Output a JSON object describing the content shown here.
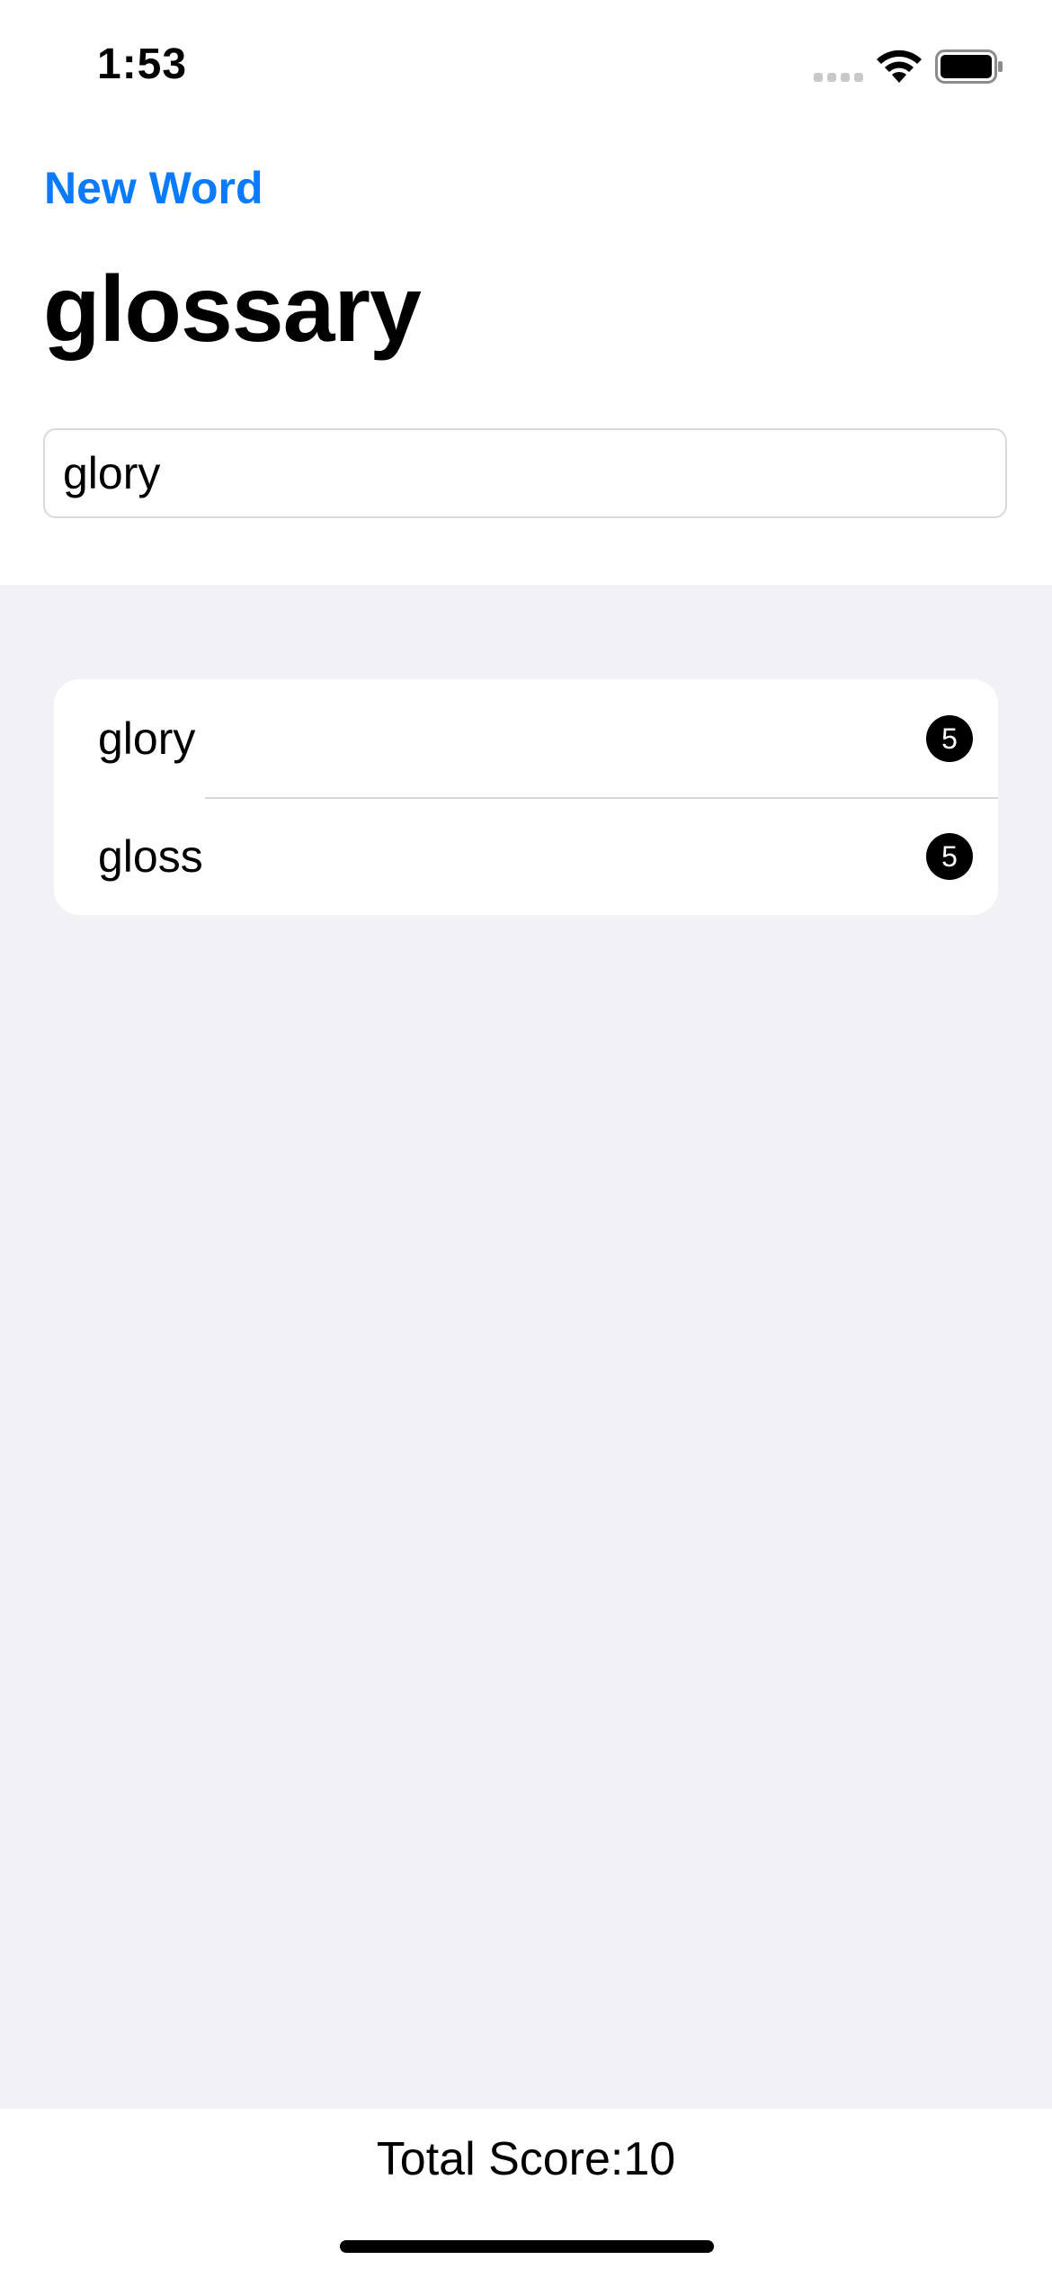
{
  "status_bar": {
    "time": "1:53",
    "icons": [
      "signal-icon",
      "wifi-icon",
      "battery-icon"
    ]
  },
  "nav": {
    "new_word_label": "New Word"
  },
  "title": "glossary",
  "input": {
    "value": "glory",
    "placeholder": ""
  },
  "words": [
    {
      "word": "glory",
      "score": "5"
    },
    {
      "word": "gloss",
      "score": "5"
    }
  ],
  "footer": {
    "total_score": "Total Score:10"
  },
  "colors": {
    "accent": "#0a7aff",
    "background_grouped": "#f1f1f6",
    "badge": "#000000"
  }
}
